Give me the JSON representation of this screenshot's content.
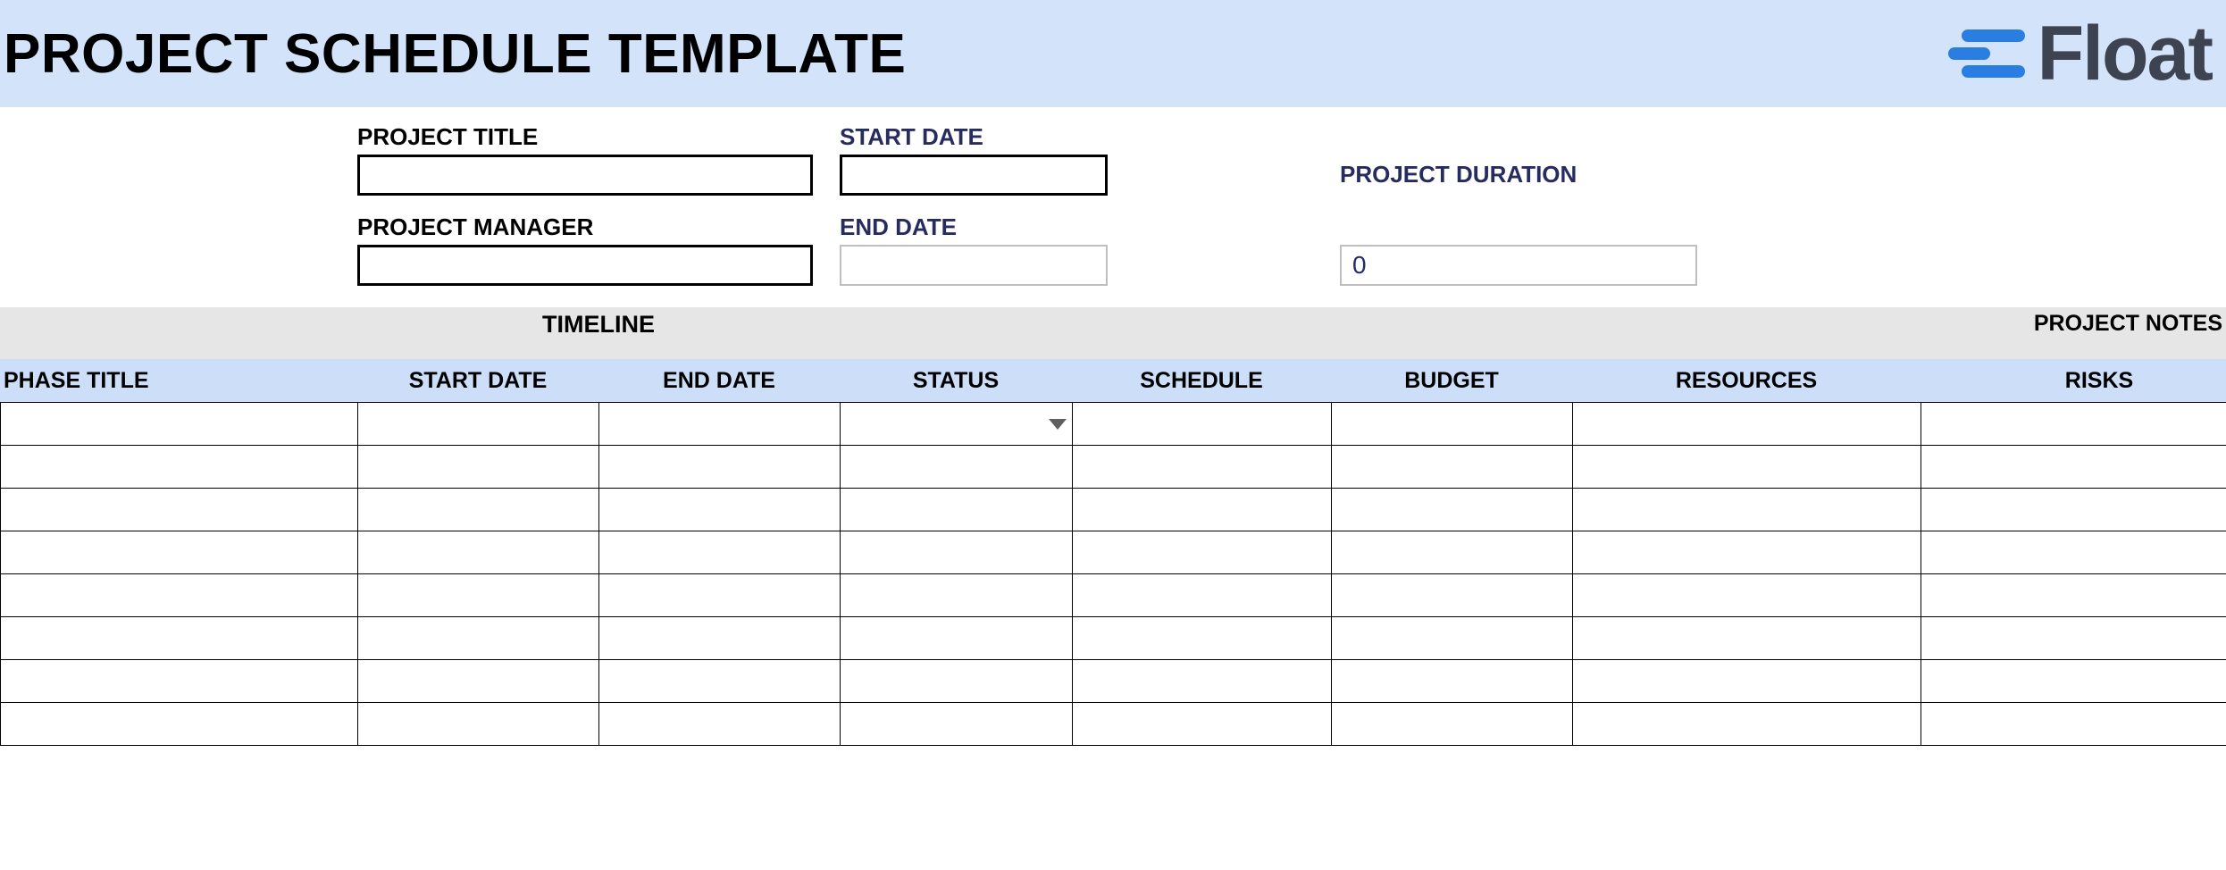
{
  "header": {
    "title": "PROJECT SCHEDULE TEMPLATE",
    "logo_text": "Float"
  },
  "meta": {
    "project_title_label": "PROJECT TITLE",
    "project_title_value": "",
    "project_manager_label": "PROJECT MANAGER",
    "project_manager_value": "",
    "start_date_label": "START DATE",
    "start_date_value": "",
    "end_date_label": "END DATE",
    "end_date_value": "",
    "project_duration_label": "PROJECT DURATION",
    "project_duration_value": "0"
  },
  "bands": {
    "timeline_label": "TIMELINE",
    "project_notes_label": "PROJECT NOTES"
  },
  "columns": {
    "phase_title": "PHASE TITLE",
    "start_date": "START DATE",
    "end_date": "END DATE",
    "status": "STATUS",
    "schedule": "SCHEDULE",
    "budget": "BUDGET",
    "resources": "RESOURCES",
    "risks": "RISKS"
  },
  "rows": [
    {
      "phase_title": "",
      "start_date": "",
      "end_date": "",
      "status": "",
      "schedule": "",
      "budget": "",
      "resources": "",
      "risks": "",
      "has_status_dropdown": true
    },
    {
      "phase_title": "",
      "start_date": "",
      "end_date": "",
      "status": "",
      "schedule": "",
      "budget": "",
      "resources": "",
      "risks": "",
      "has_status_dropdown": false
    },
    {
      "phase_title": "",
      "start_date": "",
      "end_date": "",
      "status": "",
      "schedule": "",
      "budget": "",
      "resources": "",
      "risks": "",
      "has_status_dropdown": false
    },
    {
      "phase_title": "",
      "start_date": "",
      "end_date": "",
      "status": "",
      "schedule": "",
      "budget": "",
      "resources": "",
      "risks": "",
      "has_status_dropdown": false
    },
    {
      "phase_title": "",
      "start_date": "",
      "end_date": "",
      "status": "",
      "schedule": "",
      "budget": "",
      "resources": "",
      "risks": "",
      "has_status_dropdown": false
    },
    {
      "phase_title": "",
      "start_date": "",
      "end_date": "",
      "status": "",
      "schedule": "",
      "budget": "",
      "resources": "",
      "risks": "",
      "has_status_dropdown": false
    },
    {
      "phase_title": "",
      "start_date": "",
      "end_date": "",
      "status": "",
      "schedule": "",
      "budget": "",
      "resources": "",
      "risks": "",
      "has_status_dropdown": false
    },
    {
      "phase_title": "",
      "start_date": "",
      "end_date": "",
      "status": "",
      "schedule": "",
      "budget": "",
      "resources": "",
      "risks": "",
      "has_status_dropdown": false
    }
  ]
}
